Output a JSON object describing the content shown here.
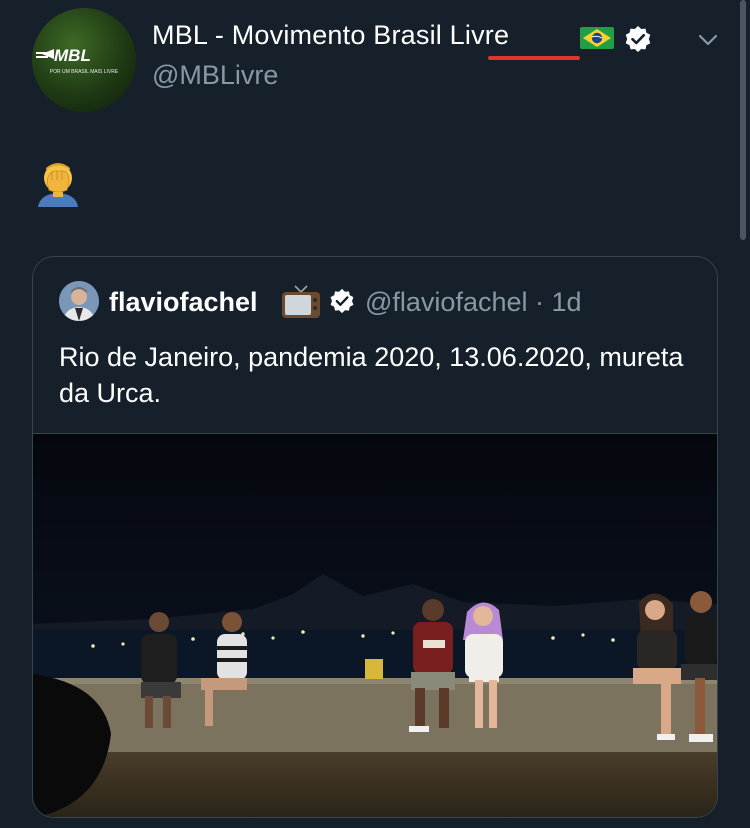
{
  "tweet": {
    "display_name": "MBL - Movimento Brasil Livre",
    "handle": "@MBLivre",
    "avatar_logo_text": "MBL",
    "avatar_tagline": "POR UM BRASIL MAIS LIVRE",
    "flag_icon": "brazil-flag-icon",
    "verified_icon": "verified-badge-icon",
    "menu_icon": "chevron-down-icon",
    "body_emoji_icon": "face-palm-emoji-icon"
  },
  "quoted_tweet": {
    "display_name": "flaviofachel",
    "name_emoji_icon": "television-emoji-icon",
    "verified_icon": "verified-badge-icon",
    "meta": "@flaviofachel · 1d",
    "text": "Rio de Janeiro, pandemia 2020, 13.06.2020, mureta da Urca.",
    "media_icon": "night-photo-people-on-seawall"
  },
  "colors": {
    "background": "#15202b",
    "secondary_text": "#8899a6",
    "border": "#38444d",
    "annotation_underline": "#e0342e"
  }
}
